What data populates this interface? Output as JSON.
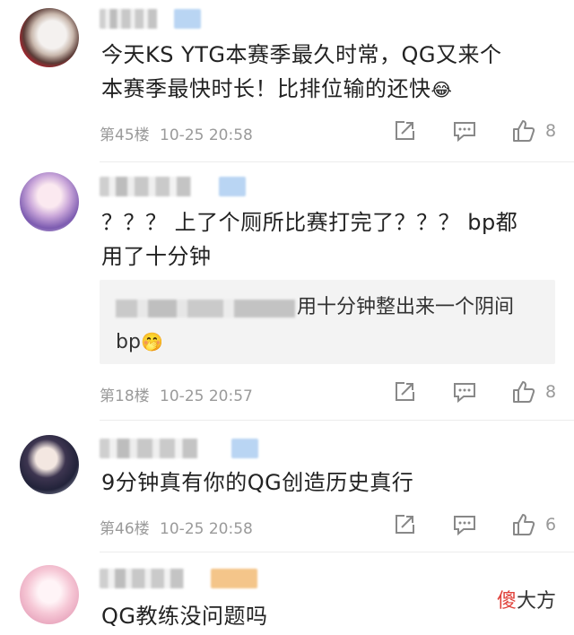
{
  "comments": [
    {
      "text_line1": "今天KS YTG本赛季最久时常，QG又来个",
      "text_line2": "本赛季最快时长！比排位输的还快",
      "emoji": "😂",
      "floor": "第45楼",
      "date": "10-25 20:58",
      "likes": "8",
      "avatar_icon": "cat-avatar-icon",
      "name_tag_color": "#b9d5f3"
    },
    {
      "text_line1": "？？？ 上了个厕所比赛打完了？？？ bp都",
      "text_line2": "用了十分钟",
      "reply_line1": "用十分钟整出来一个阴间",
      "reply_line2": "bp",
      "reply_emoji": "🤭",
      "floor": "第18楼",
      "date": "10-25 20:57",
      "likes": "8",
      "avatar_icon": "anime-girl-avatar-icon",
      "name_tag_color": "#b9d5f3"
    },
    {
      "text_line1": "9分钟真有你的QG创造历史真行",
      "floor": "第46楼",
      "date": "10-25 20:58",
      "likes": "6",
      "avatar_icon": "anime-boy-avatar-icon",
      "name_tag_color": "#b9d5f3"
    },
    {
      "text_line1": "QG教练没问题吗",
      "avatar_icon": "anime-pink-avatar-icon",
      "name_tag_color": "#f4c58a"
    }
  ],
  "icons": {
    "share": "share-icon",
    "comment": "comment-icon",
    "like": "thumbs-up-icon"
  },
  "watermark": {
    "highlight": "傻",
    "rest": "大方"
  }
}
